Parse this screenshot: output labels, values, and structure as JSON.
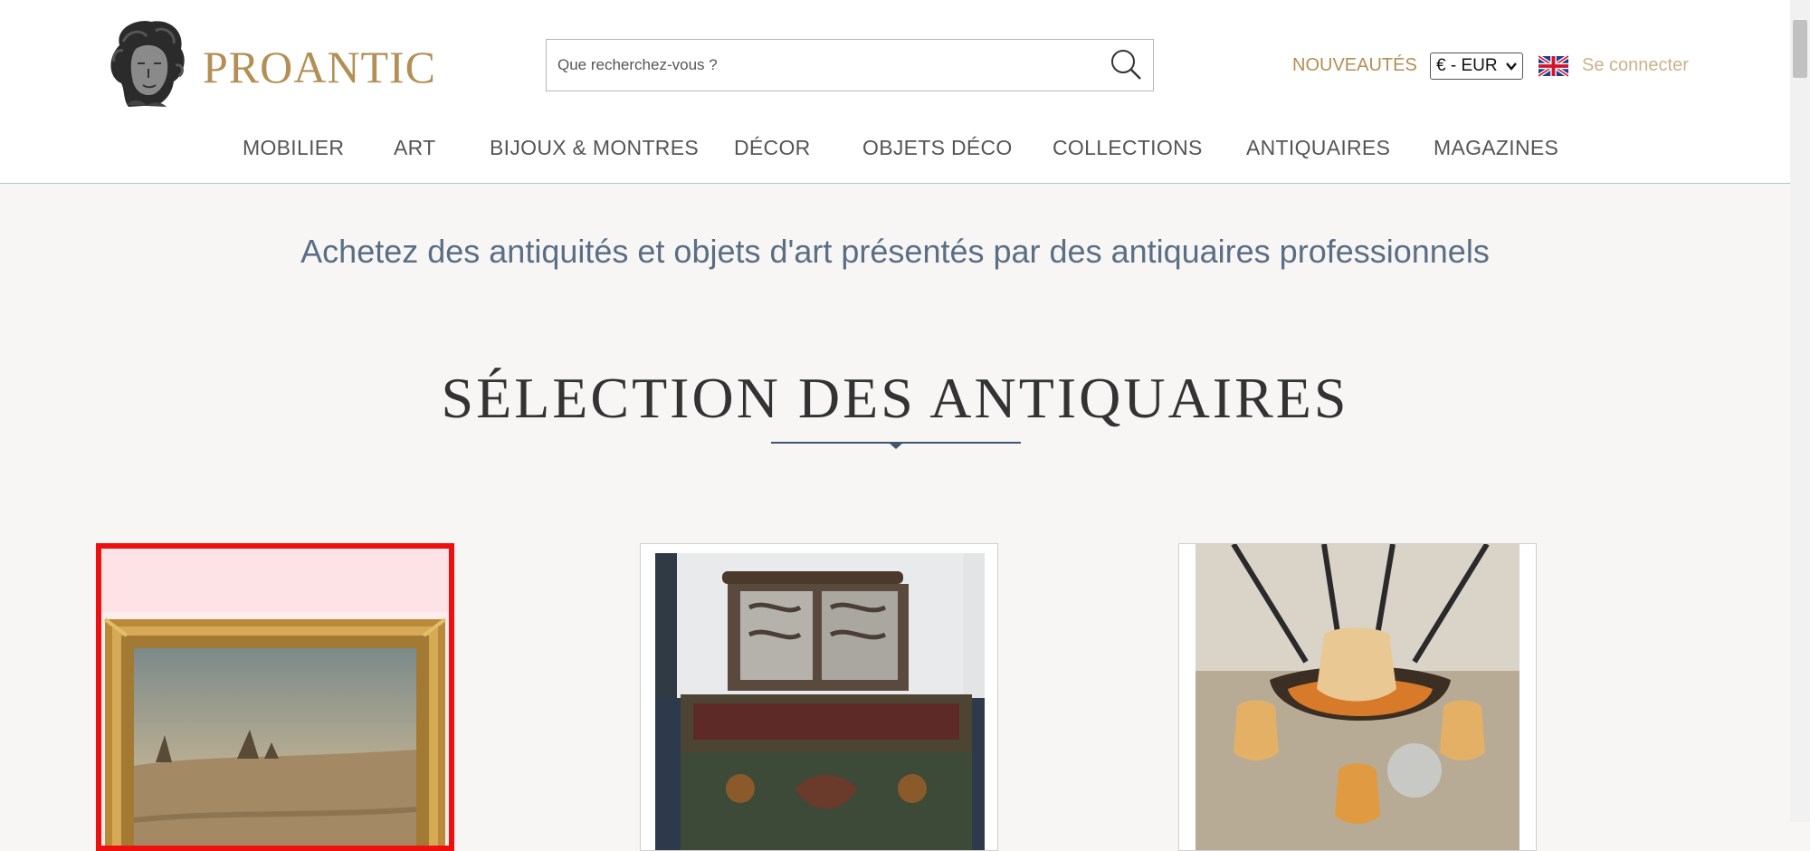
{
  "header": {
    "brand": "PROANTIC",
    "search_placeholder": "Que recherchez-vous ?",
    "nouveautes": "NOUVEAUTÉS",
    "currency": "€ - EUR",
    "login": "Se connecter"
  },
  "nav": {
    "items": [
      "MOBILIER",
      "ART",
      "BIJOUX & MONTRES",
      "DÉCOR",
      "OBJETS DÉCO",
      "COLLECTIONS",
      "ANTIQUAIRES",
      "MAGAZINES"
    ]
  },
  "tagline": "Achetez des antiquités et objets d'art présentés par des antiquaires professionnels",
  "section": {
    "title": "SÉLECTION DES ANTIQUAIRES"
  },
  "products": [
    {
      "icon": "gilt-framed-painting-image",
      "selected": true
    },
    {
      "icon": "painted-iron-chest-image",
      "selected": false
    },
    {
      "icon": "art-glass-chandelier-image",
      "selected": false
    }
  ],
  "colors": {
    "brand_gold": "#b38f55",
    "login_gold": "#cbb28a",
    "tagline_blue": "#5a6e85",
    "selection_red": "#ee0f0f",
    "page_bg": "#f7f6f4"
  }
}
